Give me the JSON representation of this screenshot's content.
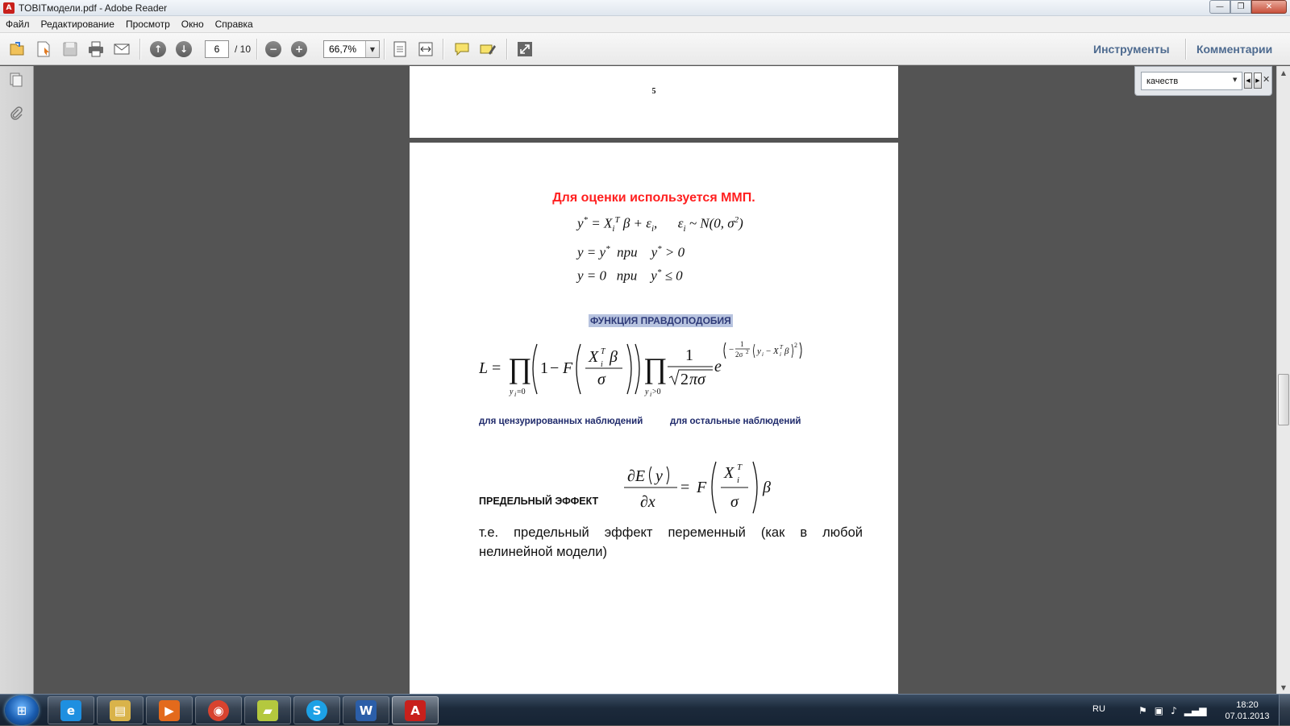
{
  "window": {
    "title": "TOBITмодели.pdf - Adobe Reader",
    "controls": {
      "minimize": "—",
      "maximize": "❐",
      "close": "✕"
    }
  },
  "menu": [
    "Файл",
    "Редактирование",
    "Просмотр",
    "Окно",
    "Справка"
  ],
  "toolbar": {
    "current_page": "6",
    "total_pages": "/ 10",
    "zoom": "66,7%",
    "tools_label": "Инструменты",
    "comments_label": "Комментарии"
  },
  "find": {
    "query": "качеств"
  },
  "document": {
    "page_number": "5",
    "heading": "Для оценки используется ММП.",
    "function_title": "ФУНКЦИЯ ПРАВДОПОДОБИЯ",
    "caption_censored": "для цензурированных наблюдений",
    "caption_others": "для остальные наблюдений",
    "marginal_label": "ПРЕДЕЛЬНЫЙ ЭФФЕКТ",
    "body_text": "т.е. предельный эффект переменный (как в любой нелинейной модели)"
  },
  "taskbar": {
    "apps": [
      {
        "name": "ie",
        "glyph": "e",
        "color": "#1e8fe0"
      },
      {
        "name": "explorer",
        "glyph": "▤",
        "color": "#d9b34a"
      },
      {
        "name": "media-player",
        "glyph": "▶",
        "color": "#e36a1c"
      },
      {
        "name": "chrome",
        "glyph": "◉",
        "color": "#d8432f"
      },
      {
        "name": "sticky-notes",
        "glyph": "▰",
        "color": "#b4c83e"
      },
      {
        "name": "skype",
        "glyph": "S",
        "color": "#1da1e6"
      },
      {
        "name": "word",
        "glyph": "W",
        "color": "#2b5ea8"
      },
      {
        "name": "adobe-reader",
        "glyph": "A",
        "color": "#c8201c"
      }
    ],
    "language": "RU",
    "time": "18:20",
    "date": "07.01.2013"
  },
  "accent_colors": {
    "heading_red": "#ff1f1f",
    "caption_blue": "#1f2a6b",
    "tools_blue": "#4d6a8f"
  }
}
